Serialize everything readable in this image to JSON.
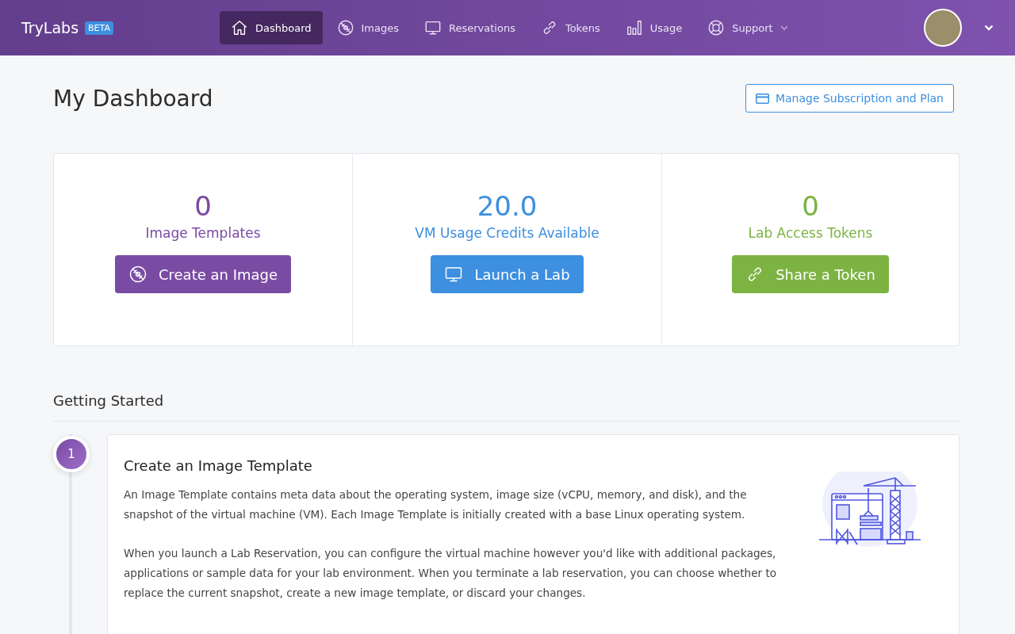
{
  "brand": {
    "name": "TryLabs",
    "badge": "BETA"
  },
  "nav": [
    {
      "label": "Dashboard",
      "kind": "home",
      "selected": true,
      "dropdown": false
    },
    {
      "label": "Images",
      "kind": "disc",
      "selected": false,
      "dropdown": false
    },
    {
      "label": "Reservations",
      "kind": "monitor",
      "selected": false,
      "dropdown": false
    },
    {
      "label": "Tokens",
      "kind": "link",
      "selected": false,
      "dropdown": false
    },
    {
      "label": "Usage",
      "kind": "bars",
      "selected": false,
      "dropdown": false
    },
    {
      "label": "Support",
      "kind": "lifebuoy",
      "selected": false,
      "dropdown": true
    }
  ],
  "page_title": "My Dashboard",
  "header_button": "Manage Subscription and Plan",
  "stats": [
    {
      "value": "0",
      "label": "Image Templates",
      "button": "Create an Image",
      "kind": "disc",
      "color": "#7a4ba3"
    },
    {
      "value": "20.0",
      "label": "VM Usage Credits Available",
      "button": "Launch a Lab",
      "kind": "monitor",
      "color": "#3d8fdf"
    },
    {
      "value": "0",
      "label": "Lab Access Tokens",
      "button": "Share a Token",
      "kind": "link",
      "color": "#7cb342"
    }
  ],
  "section_title": "Getting Started",
  "steps": [
    {
      "number": "1",
      "title": "Create an Image Template",
      "paragraphs": [
        "An Image Template contains meta data about the operating system, image size (vCPU, memory, and disk), and the snapshot of the virtual machine (VM). Each Image Template is initially created with a base Linux operating system.",
        "When you launch a Lab Reservation, you can configure the virtual machine however you'd like with additional packages, applications or sample data for your lab environment. When you terminate a lab reservation, you can choose whether to replace the current snapshot, create a new image template, or discard your changes."
      ]
    }
  ]
}
